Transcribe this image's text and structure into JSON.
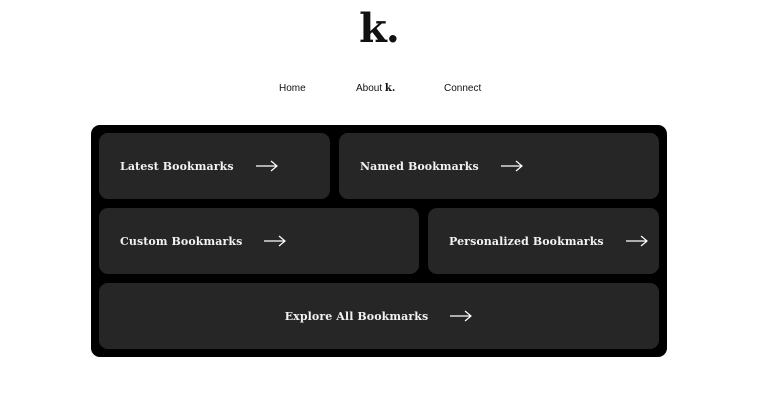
{
  "brand": {
    "logo_text": "k."
  },
  "nav": {
    "home": "Home",
    "about_prefix": "About",
    "about_brand": "k.",
    "connect": "Connect"
  },
  "cards": {
    "latest": {
      "label": "Latest Bookmarks",
      "icon": "arrow-right-icon"
    },
    "named": {
      "label": "Named Bookmarks",
      "icon": "arrow-right-icon"
    },
    "custom": {
      "label": "Custom Bookmarks",
      "icon": "arrow-right-icon"
    },
    "personalized": {
      "label": "Personalized Bookmarks",
      "icon": "arrow-right-icon"
    },
    "explore": {
      "label": "Explore All Bookmarks",
      "icon": "arrow-right-icon"
    }
  },
  "colors": {
    "panel_background": "#000000",
    "card_background": "#262626",
    "card_text": "#f2f2f2",
    "page_background": "#ffffff"
  }
}
